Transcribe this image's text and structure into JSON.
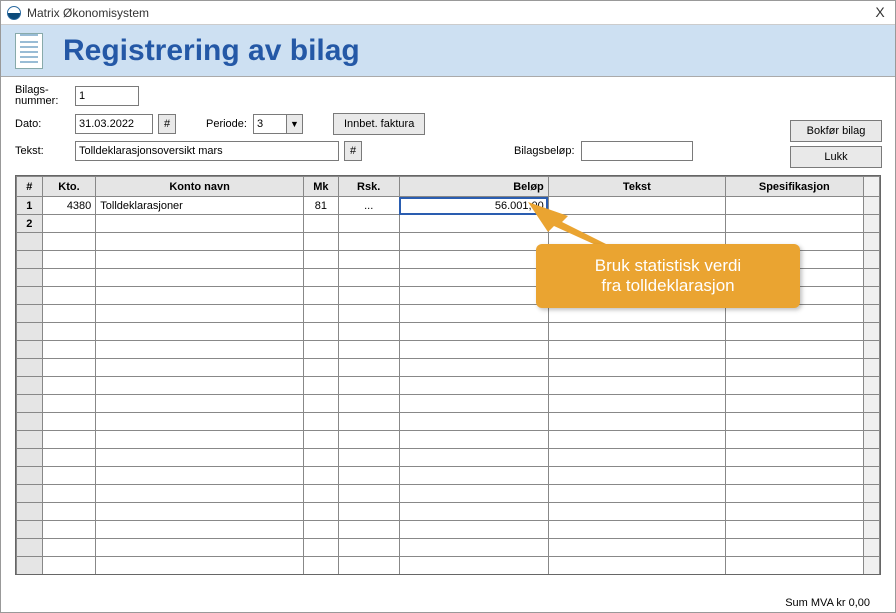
{
  "window": {
    "title": "Matrix Økonomisystem",
    "close": "X"
  },
  "header": {
    "title": "Registrering av bilag"
  },
  "form": {
    "bilagsnummer_label": "Bilags-nummer:",
    "bilagsnummer": "1",
    "dato_label": "Dato:",
    "dato": "31.03.2022",
    "hash": "#",
    "periode_label": "Periode:",
    "periode": "3",
    "innbet_btn": "Innbet. faktura",
    "bokfor_btn": "Bokfør bilag",
    "lukk_btn": "Lukk",
    "tekst_label": "Tekst:",
    "tekst": "Tolldeklarasjonsoversikt mars",
    "bilagsbelop_label": "Bilagsbeløp:",
    "bilagsbelop": ""
  },
  "table": {
    "headers": {
      "hash": "#",
      "kto": "Kto.",
      "navn": "Konto navn",
      "mk": "Mk",
      "rsk": "Rsk.",
      "belop": "Beløp",
      "tekst": "Tekst",
      "spes": "Spesifikasjon"
    },
    "rows": [
      {
        "n": "1",
        "kto": "4380",
        "navn": "Tolldeklarasjoner",
        "mk": "81",
        "rsk": "...",
        "belop": "56.001,00",
        "tekst": "",
        "spes": ""
      },
      {
        "n": "2",
        "kto": "",
        "navn": "",
        "mk": "",
        "rsk": "",
        "belop": "",
        "tekst": "",
        "spes": ""
      }
    ]
  },
  "callout": {
    "line1": "Bruk statistisk verdi",
    "line2": "fra tolldeklarasjon"
  },
  "footer": {
    "sum": "Sum MVA kr 0,00"
  }
}
